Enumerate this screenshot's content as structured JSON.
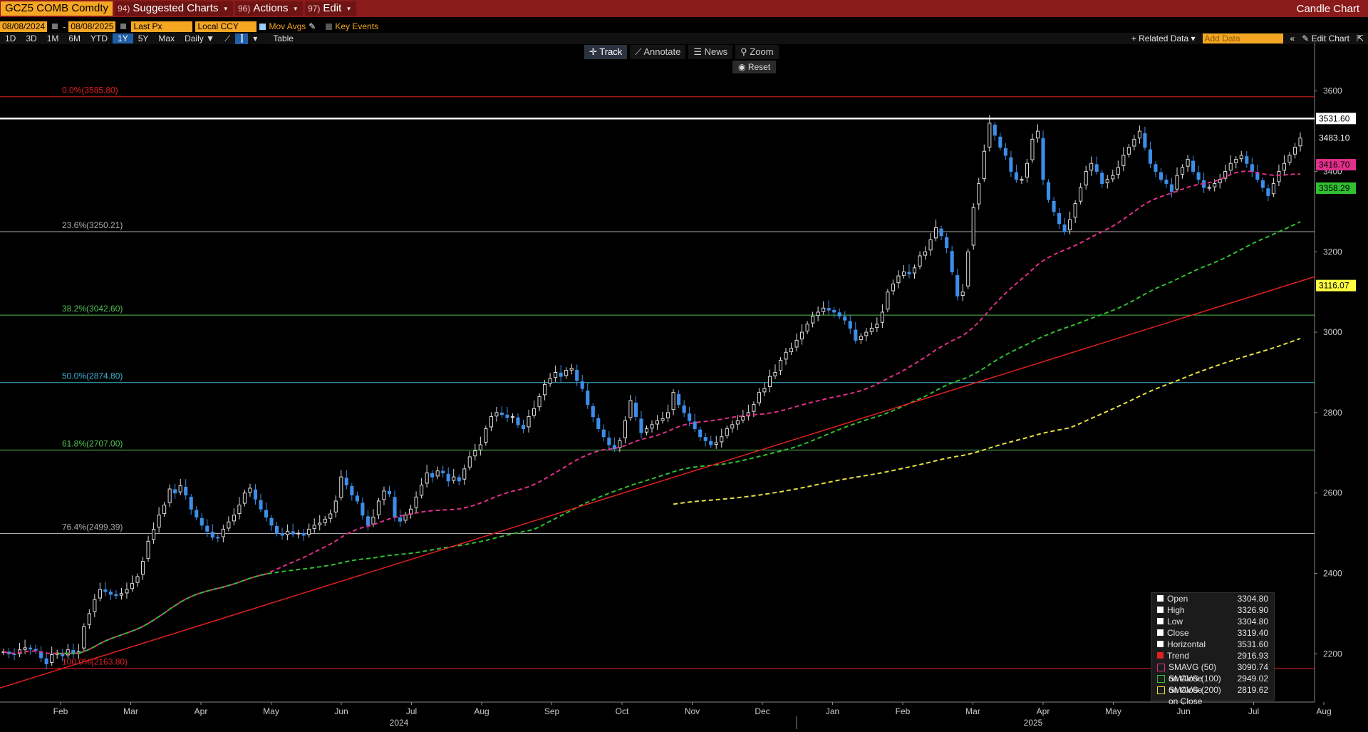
{
  "toolbar": {
    "ticker": "GCZ5 COMB Comdty",
    "menus": [
      {
        "num": "94)",
        "label": "Suggested Charts"
      },
      {
        "num": "96)",
        "label": "Actions"
      },
      {
        "num": "97)",
        "label": "Edit"
      }
    ],
    "chart_type": "Candle Chart",
    "start_date": "08/08/2024",
    "end_date": "08/08/2025",
    "field": "Last Px",
    "currency": "Local CCY",
    "mov_avgs": "Mov Avgs",
    "key_events": "Key Events",
    "ranges": [
      "1D",
      "3D",
      "1M",
      "6M",
      "YTD",
      "1Y",
      "5Y",
      "Max"
    ],
    "active_range": "1Y",
    "period": "Daily",
    "table": "Table",
    "related_data": "Related Data",
    "add_data_placeholder": "Add Data",
    "edit_chart": "Edit Chart",
    "tools": [
      "Track",
      "Annotate",
      "News",
      "Zoom"
    ],
    "reset": "Reset"
  },
  "legend": {
    "rows": [
      {
        "name": "Open",
        "value": "3304.80",
        "color": "#ffffff"
      },
      {
        "name": "High",
        "value": "3326.90",
        "color": "#ffffff"
      },
      {
        "name": "Low",
        "value": "3304.80",
        "color": "#ffffff"
      },
      {
        "name": "Close",
        "value": "3319.40",
        "color": "#ffffff"
      },
      {
        "name": "Horizontal",
        "value": "3531.60",
        "color": "#ffffff"
      },
      {
        "name": "Trend",
        "value": "2916.93",
        "color": "#e02020"
      },
      {
        "name": "SMAVG (50)  on Close",
        "value": "3090.74",
        "color": "#e0308a"
      },
      {
        "name": "SMAVG (100)  on Close",
        "value": "2949.02",
        "color": "#30c030"
      },
      {
        "name": "SMAVG (200)  on Close",
        "value": "2819.62",
        "color": "#e6e040"
      }
    ]
  },
  "chart_data": {
    "type": "candlestick",
    "ylim": [
      2080,
      3720
    ],
    "yticks": [
      2200,
      2400,
      2600,
      2800,
      3000,
      3200,
      3400,
      3600
    ],
    "x_months": [
      "Feb",
      "Mar",
      "Apr",
      "May",
      "Jun",
      "Jul",
      "Aug",
      "Sep",
      "Oct",
      "Nov",
      "Dec",
      "Jan",
      "Feb",
      "Mar",
      "Apr",
      "May",
      "Jun",
      "Jul",
      "Aug"
    ],
    "x_years": [
      "2024",
      "2025"
    ],
    "price_tags": [
      {
        "label": "3531.60",
        "value": 3531.6,
        "color": "#ffffff",
        "text": "#000000"
      },
      {
        "label": "3483.10",
        "value": 3483.1,
        "color": "#000000",
        "text": "#ffffff"
      },
      {
        "label": "3416.70",
        "value": 3416.7,
        "color": "#e0308a",
        "text": "#000000"
      },
      {
        "label": "3358.29",
        "value": 3358.29,
        "color": "#30c030",
        "text": "#000000"
      },
      {
        "label": "3116.07",
        "value": 3116.07,
        "color": "#ffff40",
        "text": "#000000"
      }
    ],
    "horizontal_line": 3531.6,
    "fibonacci": [
      {
        "label": "0.0%(3585.80)",
        "value": 3585.8,
        "color": "#e02020"
      },
      {
        "label": "23.6%(3250.21)",
        "value": 3250.21,
        "color": "#aaaaaa"
      },
      {
        "label": "38.2%(3042.60)",
        "value": 3042.6,
        "color": "#50c050"
      },
      {
        "label": "50.0%(2874.80)",
        "value": 2874.8,
        "color": "#40b0d0"
      },
      {
        "label": "61.8%(2707.00)",
        "value": 2707.0,
        "color": "#50c050"
      },
      {
        "label": "76.4%(2499.39)",
        "value": 2499.39,
        "color": "#aaaaaa"
      },
      {
        "label": "100.0%(2163.80)",
        "value": 2163.8,
        "color": "#e02020"
      }
    ],
    "trend_line": {
      "start": 2115,
      "end": 3138
    },
    "closes": [
      2205,
      2200,
      2198,
      2210,
      2215,
      2212,
      2208,
      2190,
      2175,
      2198,
      2202,
      2195,
      2210,
      2200,
      2205,
      2268,
      2300,
      2335,
      2360,
      2355,
      2348,
      2345,
      2350,
      2360,
      2375,
      2392,
      2430,
      2480,
      2510,
      2545,
      2570,
      2610,
      2600,
      2618,
      2595,
      2560,
      2540,
      2520,
      2505,
      2490,
      2488,
      2510,
      2528,
      2545,
      2570,
      2600,
      2612,
      2585,
      2560,
      2540,
      2520,
      2500,
      2495,
      2505,
      2498,
      2500,
      2495,
      2510,
      2520,
      2525,
      2535,
      2548,
      2580,
      2640,
      2620,
      2595,
      2580,
      2545,
      2520,
      2540,
      2580,
      2605,
      2598,
      2540,
      2530,
      2545,
      2560,
      2590,
      2620,
      2650,
      2640,
      2655,
      2650,
      2630,
      2640,
      2630,
      2660,
      2690,
      2705,
      2720,
      2760,
      2790,
      2800,
      2795,
      2788,
      2790,
      2770,
      2760,
      2790,
      2810,
      2840,
      2870,
      2885,
      2900,
      2890,
      2905,
      2910,
      2880,
      2860,
      2820,
      2790,
      2760,
      2740,
      2720,
      2710,
      2730,
      2780,
      2830,
      2790,
      2750,
      2760,
      2770,
      2780,
      2785,
      2800,
      2850,
      2820,
      2800,
      2780,
      2760,
      2740,
      2730,
      2720,
      2725,
      2740,
      2760,
      2770,
      2780,
      2790,
      2800,
      2820,
      2850,
      2860,
      2890,
      2900,
      2930,
      2950,
      2960,
      2980,
      3000,
      3020,
      3040,
      3050,
      3060,
      3055,
      3050,
      3040,
      3030,
      3010,
      2980,
      2990,
      3000,
      3010,
      3020,
      3050,
      3100,
      3120,
      3140,
      3150,
      3145,
      3160,
      3190,
      3200,
      3230,
      3260,
      3240,
      3210,
      3150,
      3090,
      3100,
      3200,
      3310,
      3370,
      3450,
      3520,
      3490,
      3460,
      3440,
      3400,
      3380,
      3380,
      3420,
      3480,
      3500,
      3380,
      3330,
      3300,
      3270,
      3250,
      3280,
      3320,
      3360,
      3400,
      3420,
      3400,
      3370,
      3380,
      3390,
      3410,
      3440,
      3460,
      3480,
      3500,
      3460,
      3420,
      3400,
      3380,
      3370,
      3350,
      3390,
      3410,
      3430,
      3400,
      3380,
      3360,
      3360,
      3370,
      3380,
      3400,
      3420,
      3430,
      3440,
      3420,
      3400,
      3380,
      3360,
      3340,
      3370,
      3400,
      3420,
      3440,
      3460,
      3483
    ]
  }
}
